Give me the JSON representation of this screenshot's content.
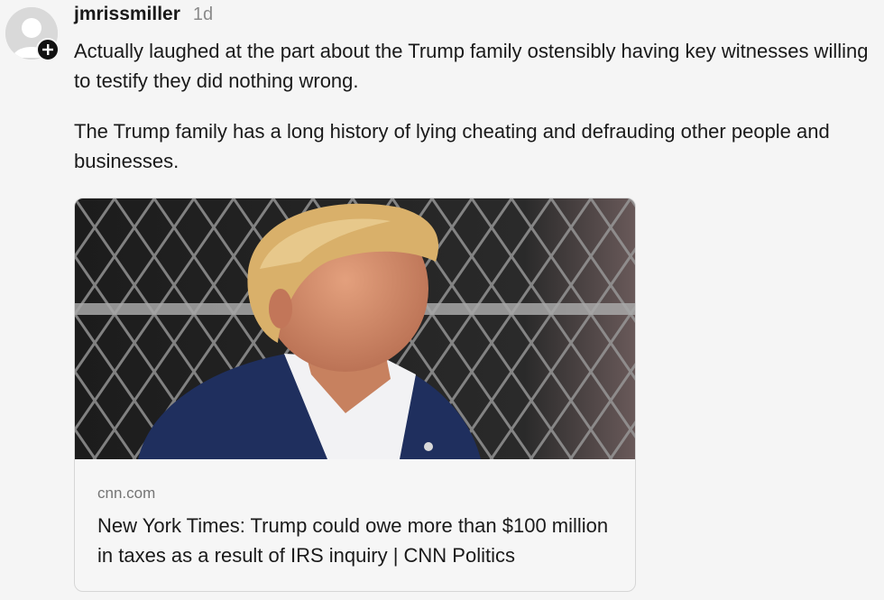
{
  "comment": {
    "username": "jmrissmiller",
    "timestamp": "1d",
    "paragraphs": [
      "Actually laughed at the part about the Trump family ostensibly having key witnesses willing to testify they did nothing wrong.",
      "The Trump family has a long history of lying cheating and defrauding other people and businesses."
    ]
  },
  "link_card": {
    "source": "cnn.com",
    "title": "New York Times: Trump could owe more than $100 million in taxes as a result of IRS inquiry | CNN Politics"
  },
  "icons": {
    "avatar": "default-user-avatar",
    "follow": "plus-icon"
  },
  "colors": {
    "background": "#f5f5f5",
    "text": "#1a1a1a",
    "muted": "#8a8a8a",
    "card_border": "#d6d6d6"
  }
}
